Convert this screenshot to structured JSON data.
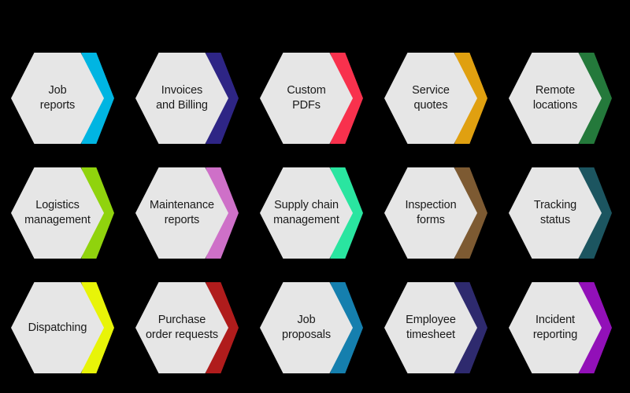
{
  "diagram": {
    "type": "hexagon-grid-process",
    "background_color": "#000000",
    "hexagon_fill": "#e6e6e6",
    "label_color": "#1a1a1a",
    "rows": 3,
    "columns": 5,
    "items": [
      {
        "label": "Job\nreports",
        "accent_color": "#00b5e2"
      },
      {
        "label": "Invoices\nand Billing",
        "accent_color": "#2e2585"
      },
      {
        "label": "Custom\nPDFs",
        "accent_color": "#f8314d"
      },
      {
        "label": "Service\nquotes",
        "accent_color": "#e0a010"
      },
      {
        "label": "Remote\nlocations",
        "accent_color": "#24793b"
      },
      {
        "label": "Logistics\nmanagement",
        "accent_color": "#90d30d"
      },
      {
        "label": "Maintenance\nreports",
        "accent_color": "#ce70c8"
      },
      {
        "label": "Supply chain\nmanagement",
        "accent_color": "#2ae5a0"
      },
      {
        "label": "Inspection\nforms",
        "accent_color": "#7d5a32"
      },
      {
        "label": "Tracking\nstatus",
        "accent_color": "#1c5560"
      },
      {
        "label": "Dispatching",
        "accent_color": "#e8f408"
      },
      {
        "label": "Purchase\norder requests",
        "accent_color": "#b01c1c"
      },
      {
        "label": "Job\nproposals",
        "accent_color": "#157fae"
      },
      {
        "label": "Employee\ntimesheet",
        "accent_color": "#2e2a6e"
      },
      {
        "label": "Incident\nreporting",
        "accent_color": "#9210b8"
      }
    ]
  }
}
